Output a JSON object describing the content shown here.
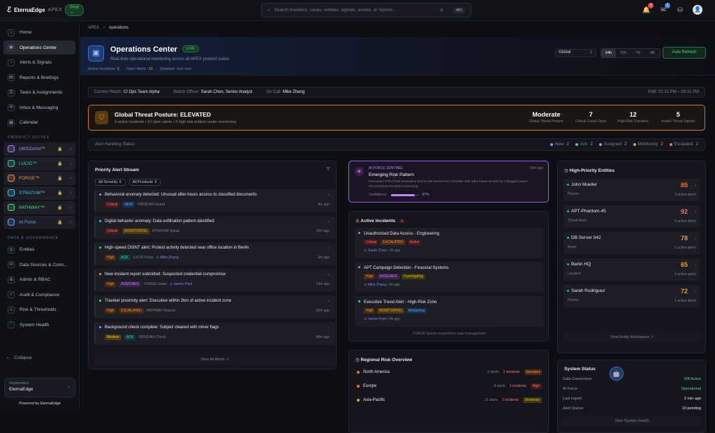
{
  "app": {
    "brand": "EternaEdge",
    "product": "APEX",
    "env": "Prod",
    "env_chev": "⌄",
    "logo_glyph": "ℰ"
  },
  "search": {
    "placeholder": "Search travelers, cases, entities, signals, assets, or reports...",
    "kbd": "⌘K"
  },
  "top_badges": {
    "alerts": "3",
    "messages": "2"
  },
  "sidebar": {
    "items": [
      {
        "label": "Home",
        "icon": "home-icon",
        "glyph": "⌂"
      },
      {
        "label": "Operations Center",
        "icon": "monitor-icon",
        "glyph": "▣"
      },
      {
        "label": "Alerts & Signals",
        "icon": "bell-icon",
        "glyph": "◔"
      },
      {
        "label": "Reports & Briefings",
        "icon": "file-icon",
        "glyph": "▤"
      },
      {
        "label": "Tasks & Assignments",
        "icon": "checklist-icon",
        "glyph": "☰"
      },
      {
        "label": "Inbox & Messaging",
        "icon": "inbox-icon",
        "glyph": "✉"
      },
      {
        "label": "Calendar",
        "icon": "calendar-icon",
        "glyph": "▦"
      }
    ],
    "suites_title": "PRODUCT SUITES",
    "suites": [
      {
        "label": "OBSIDIAN™",
        "color": "#a78bfa"
      },
      {
        "label": "LUCID™",
        "color": "#34d399"
      },
      {
        "label": "FORGE™",
        "color": "#fb923c"
      },
      {
        "label": "STRATUM™",
        "color": "#22d3ee"
      },
      {
        "label": "PATHWAY™",
        "color": "#4ade80"
      },
      {
        "label": "AI Force",
        "color": "#60a5fa"
      }
    ],
    "dg_title": "DATA & GOVERNANCE",
    "dg": [
      {
        "label": "Entities",
        "glyph": "◎"
      },
      {
        "label": "Data Sources & Conn...",
        "glyph": "⛁"
      },
      {
        "label": "Admin & RBAC",
        "glyph": "⚙"
      },
      {
        "label": "Audit & Compliance",
        "glyph": "✓"
      },
      {
        "label": "Risk & Thresholds",
        "glyph": "⚠"
      },
      {
        "label": "System Health",
        "glyph": "♡"
      }
    ],
    "collapse": "Collapse",
    "collapse_glyph": "‹",
    "org_label": "Organization",
    "org_value": "EternaEdge",
    "powered": "Powered by EternaEdge"
  },
  "breadcrumb": {
    "root": "APEX",
    "sep": "›",
    "current": "operations"
  },
  "header": {
    "title": "Operations Center",
    "live": "LIVE",
    "subtitle": "Real-time operational monitoring across all APEX product suites",
    "meta": [
      {
        "label": "Active Incidents:",
        "value": "3"
      },
      {
        "label": "Open Alerts:",
        "value": "10"
      },
      {
        "label": "Updated:",
        "value": "Just now"
      }
    ],
    "region": "Global",
    "ranges": [
      "24h",
      "72h",
      "7d",
      "All"
    ],
    "refresh": "Auto Refresh"
  },
  "watch": {
    "current_label": "Current Watch:",
    "current": "CI Ops Team Alpha",
    "officer_label": "Watch Officer:",
    "officer": "Sarah Chen, Senior Analyst",
    "oncall_label": "On Call:",
    "oncall": "Mike Zhang",
    "shift": "Shift: 01:31 PM – 09:31 PM"
  },
  "threat": {
    "title": "Global Threat Posture: ELEVATED",
    "summary": "3 active incidents • 10 open alerts • 3 high-risk entities under monitoring",
    "stats": [
      {
        "value": "Moderate",
        "label": "Global Threat Posture"
      },
      {
        "value": "7",
        "label": "Critical Cases Open"
      },
      {
        "value": "12",
        "label": "High-Risk Travelers"
      },
      {
        "value": "5",
        "label": "Insider Threat Signals"
      }
    ]
  },
  "handling": {
    "label": "Alert Handling Status:",
    "legend": [
      {
        "label": "New:",
        "value": "2",
        "color": "#60a5fa"
      },
      {
        "label": "Ack:",
        "value": "2",
        "color": "#2dd4bf"
      },
      {
        "label": "Assigned:",
        "value": "2",
        "color": "#c084fc"
      },
      {
        "label": "Monitoring:",
        "value": "2",
        "color": "#f59e0b"
      },
      {
        "label": "Escalated:",
        "value": "2",
        "color": "#f87171"
      }
    ]
  },
  "alerts": {
    "title": "Priority Alert Stream",
    "filter_severity": "All Severity",
    "filter_products": "All Products",
    "items": [
      {
        "title": "Behavioral anomaly detected: Unusual after-hours access to classified documents",
        "severity": "Critical",
        "status": "NEW",
        "source": "OBSIDIAN Guard",
        "owner": "",
        "time": "4m ago",
        "dot": "#a78bfa"
      },
      {
        "title": "Digital behavior anomaly: Data exfiltration pattern identified",
        "severity": "Critical",
        "status": "MONITORING",
        "source": "STRATUM Signal",
        "owner": "",
        "time": "19m ago",
        "dot": "#22d3ee"
      },
      {
        "title": "High-speed OSINT alert: Protest activity detected near office location in Berlin",
        "severity": "High",
        "status": "ACK",
        "source": "LUCID Pulse",
        "owner": "Mike Zhang",
        "time": "9m ago",
        "dot": "#34d399"
      },
      {
        "title": "New incident report submitted: Suspected credential compromise",
        "severity": "High",
        "status": "ASSIGNED",
        "source": "FORGE Intake",
        "owner": "James Park",
        "time": "13m ago",
        "dot": "#fb923c"
      },
      {
        "title": "Traveler proximity alert: Executive within 2km of active incident zone",
        "severity": "High",
        "status": "ESCALATED",
        "source": "PATHWAY Beacon",
        "owner": "",
        "time": "26m ago",
        "dot": "#4ade80"
      },
      {
        "title": "Background check complete: Subject cleared with minor flags",
        "severity": "Medium",
        "status": "ACK",
        "source": "OBSIDIAN Check",
        "owner": "",
        "time": "48m ago",
        "dot": "#a78bfa"
      }
    ],
    "view_all": "View All Alerts"
  },
  "sentinel": {
    "label": "AI FORCE SENTINEL",
    "title": "Emerging Risk Pattern",
    "desc": "Increased STRATUM anomalies tied to DB Server 042 correlate with after-hours access by 2 flagged users. Recommend elevated monitoring.",
    "time": "15m ago",
    "confidence_label": "Confidence:",
    "confidence": "87%",
    "confidence_value": 0.87
  },
  "incidents": {
    "title": "Active Incidents",
    "count": "3",
    "items": [
      {
        "title": "Unauthorized Data Access - Engineering",
        "tags": [
          "Critical",
          "ESCALATED",
          "Active"
        ],
        "owner": "Sarah Chen",
        "time": "2h ago",
        "dot": "#a78bfa"
      },
      {
        "title": "APT Campaign Detection - Financial Systems",
        "tags": [
          "High",
          "ASSIGNED",
          "Investigating"
        ],
        "owner": "Mike Zhang",
        "time": "5h ago",
        "dot": "#22d3ee"
      },
      {
        "title": "Executive Travel Alert - High-Risk Zone",
        "tags": [
          "High",
          "MONITORING",
          "Monitoring"
        ],
        "owner": "James Park",
        "time": "8h ago",
        "dot": "#4ade80"
      }
    ],
    "footer": "FORGE license required for case management"
  },
  "regional": {
    "title": "Regional Risk Overview",
    "items": [
      {
        "name": "North America",
        "alerts": "5 alerts",
        "incidents": "2 incidents",
        "level": "Elevated",
        "dot": "#f97316"
      },
      {
        "name": "Europe",
        "alerts": "8 alerts",
        "incidents": "3 incidents",
        "level": "High",
        "dot": "#f97316"
      },
      {
        "name": "Asia-Pacific",
        "alerts": "12 alerts",
        "incidents": "1 incidents",
        "level": "Moderate",
        "dot": "#f59e0b"
      }
    ]
  },
  "entities": {
    "title": "High-Priority Entities",
    "items": [
      {
        "name": "John Mueller",
        "type": "Person",
        "score": "85",
        "alerts": "3 active alerts",
        "color": "#f97316"
      },
      {
        "name": "APT-Phantom-45",
        "type": "Threat Actor",
        "score": "92",
        "alerts": "5 active alerts",
        "color": "#f87171"
      },
      {
        "name": "DB Server 042",
        "type": "Asset",
        "score": "78",
        "alerts": "2 active alerts",
        "color": "#fb923c"
      },
      {
        "name": "Berlin HQ",
        "type": "Location",
        "score": "65",
        "alerts": "4 active alerts",
        "color": "#f59e0b"
      },
      {
        "name": "Sarah Rodriguez",
        "type": "Person",
        "score": "72",
        "alerts": "1 active alerts",
        "color": "#f59e0b"
      }
    ],
    "view": "View Entity Workspace"
  },
  "system": {
    "title": "System Status",
    "rows": [
      {
        "label": "Data Connectors",
        "value": "8/8 Active",
        "ok": true
      },
      {
        "label": "AI Force",
        "value": "Operational",
        "ok": true
      },
      {
        "label": "Last Ingest",
        "value": "2 min ago",
        "ok": false
      },
      {
        "label": "Alert Queue",
        "value": "10 pending",
        "ok": false
      }
    ],
    "view": "View System Health"
  },
  "glyphs": {
    "search": "⌕",
    "bell": "🔔",
    "mail": "✉",
    "layers": "⛁",
    "user": "👤",
    "lock": "🔒",
    "chev": "›",
    "ext": "↗",
    "shield": "⛉",
    "person": "♙",
    "phone": "☏",
    "clock": "◷",
    "warn": "⚠",
    "filter": "⛛",
    "diamond": "◈",
    "info": "ⓘ",
    "filters_glyph": "☰",
    "bot": "🤖",
    "monitor": "▣",
    "dot_sep": "•",
    "sort": "⇕"
  }
}
